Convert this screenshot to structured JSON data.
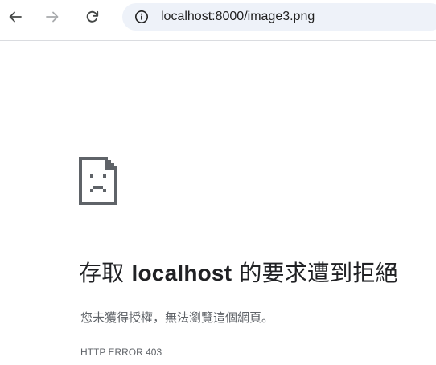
{
  "toolbar": {
    "back_icon": "arrow-left-icon",
    "forward_icon": "arrow-right-icon",
    "reload_icon": "reload-icon",
    "site_info_icon": "info-icon",
    "url": "localhost:8000/image3.png"
  },
  "error": {
    "icon": "sad-page-icon",
    "title_prefix": "存取 ",
    "title_host": "localhost",
    "title_suffix": " 的要求遭到拒絕",
    "description": "您未獲得授權，無法瀏覽這個網頁。",
    "code": "HTTP ERROR 403"
  },
  "colors": {
    "omnibox_bg": "#eef2f9",
    "text_primary": "#202124",
    "text_secondary": "#5f6368"
  }
}
